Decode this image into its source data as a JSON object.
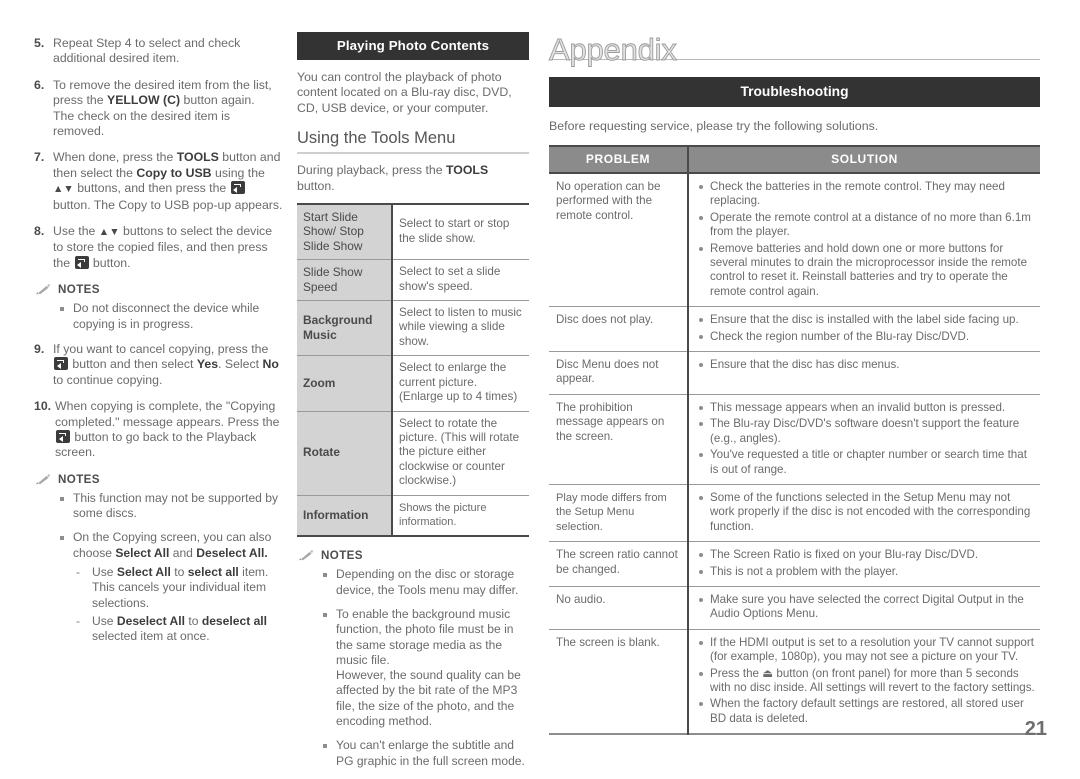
{
  "page": {
    "number": "21"
  },
  "left_column": {
    "steps": [
      {
        "num": "5.",
        "text": "Repeat Step 4 to select and check additional desired item."
      },
      {
        "num": "6.",
        "text": "To remove the desired item from the list, press the YELLOW (C) button again.\nThe check on the desired item is removed.",
        "bold_parts": [
          "YELLOW (C)"
        ]
      },
      {
        "num": "7.",
        "text": "When done, press the TOOLS button and then select the Copy to USB using the ▲▼ buttons, and then press the [ENTER] button. The Copy to USB pop-up appears.",
        "bold_parts": [
          "TOOLS",
          "Copy to USB"
        ]
      },
      {
        "num": "8.",
        "text": "Use the ▲▼ buttons to select the device to store the copied files, and then press the [ENTER] button."
      },
      {
        "num": "9.",
        "text": "If you want to cancel copying, press the [ENTER] button and then select Yes. Select No to continue copying.",
        "bold_parts": [
          "Yes",
          "No"
        ]
      },
      {
        "num": "10.",
        "text": "When copying is complete, the \"Copying completed.\" message appears. Press the [ENTER] button to go back to the Playback screen."
      }
    ],
    "notes_label": "NOTES",
    "notes_1": [
      "Do not disconnect the device while copying is in progress."
    ],
    "notes_2": [
      "This function may not be supported by some discs.",
      "On the Copying screen, you can also choose Select All and Deselect All."
    ],
    "notes_2_sub": [
      "Use Select All to select all item. This cancels your individual item selections.",
      "Use Deselect All to deselect all selected item at once."
    ]
  },
  "mid_column": {
    "section_title": "Playing Photo Contents",
    "intro": "You can control the playback of photo content located on a Blu-ray disc, DVD, CD, USB device, or your computer.",
    "subheading": "Using the Tools Menu",
    "tools_intro": "During playback, press the TOOLS button.",
    "tools_intro_bold": "TOOLS",
    "tools_table": [
      {
        "key": "Start Slide Show/ Stop Slide Show",
        "value": "Select to start or stop the slide show."
      },
      {
        "key": "Slide Show Speed",
        "value": "Select to set a slide show's speed."
      },
      {
        "key": "Background Music",
        "value": "Select to listen to music while viewing a slide show."
      },
      {
        "key": "Zoom",
        "value": "Select to enlarge the current picture. (Enlarge up to 4 times)"
      },
      {
        "key": "Rotate",
        "value": "Select to rotate the picture. (This will rotate the picture either clockwise or counter clockwise.)"
      },
      {
        "key": "Information",
        "value": "Shows the picture information."
      }
    ],
    "notes_label": "NOTES",
    "notes": [
      "Depending on the disc or storage device, the Tools menu may differ.",
      "To enable the background music function, the photo file must be in the same storage media as the music file.\nHowever, the sound quality can be affected by the bit rate of the MP3 file, the size of the photo, and the encoding method.",
      "You can't enlarge the subtitle and PG graphic in the full screen mode."
    ]
  },
  "right_column": {
    "title": "Appendix",
    "section_title": "Troubleshooting",
    "intro": "Before requesting service, please try the following solutions.",
    "table_headers": {
      "problem": "PROBLEM",
      "solution": "SOLUTION"
    },
    "rows": [
      {
        "problem": "No operation can be performed with the remote control.",
        "solutions": [
          "Check the batteries in the remote control. They may need replacing.",
          "Operate the remote control at a distance of no more than 6.1m from the player.",
          "Remove batteries and hold down one or more buttons for several minutes to drain the microprocessor inside the remote control to reset it. Reinstall batteries and try to operate the remote control again."
        ]
      },
      {
        "problem": "Disc does not play.",
        "solutions": [
          "Ensure that the disc is installed with the label side facing up.",
          "Check the region number of the Blu-ray Disc/DVD."
        ]
      },
      {
        "problem": "Disc Menu does not appear.",
        "solutions": [
          "Ensure that the disc has disc menus."
        ]
      },
      {
        "problem": "The prohibition message appears on the screen.",
        "solutions": [
          "This message appears when an invalid button is pressed.",
          "The Blu-ray Disc/DVD's software doesn't support the feature (e.g., angles).",
          "You've requested a title or chapter number or search time that is out of range."
        ]
      },
      {
        "problem": "Play mode differs from the Setup Menu selection.",
        "solutions": [
          "Some of the functions selected in the Setup Menu may not work properly if the disc is not encoded with the corresponding function."
        ]
      },
      {
        "problem": "The screen ratio cannot be changed.",
        "solutions": [
          "The Screen Ratio is fixed on your Blu-ray Disc/DVD.",
          "This is not a problem with the player."
        ]
      },
      {
        "problem": "No audio.",
        "solutions": [
          "Make sure you have selected the correct Digital Output in the Audio Options Menu."
        ]
      },
      {
        "problem": "The screen is blank.",
        "solutions": [
          "If the HDMI output is set to a resolution your TV cannot support (for example, 1080p), you may not see a picture on your TV.",
          "Press the ⏏ button (on front panel) for more than 5 seconds with no disc inside. All settings will revert to the factory settings.",
          "When the factory default settings are restored, all stored user BD data is deleted."
        ]
      }
    ]
  }
}
